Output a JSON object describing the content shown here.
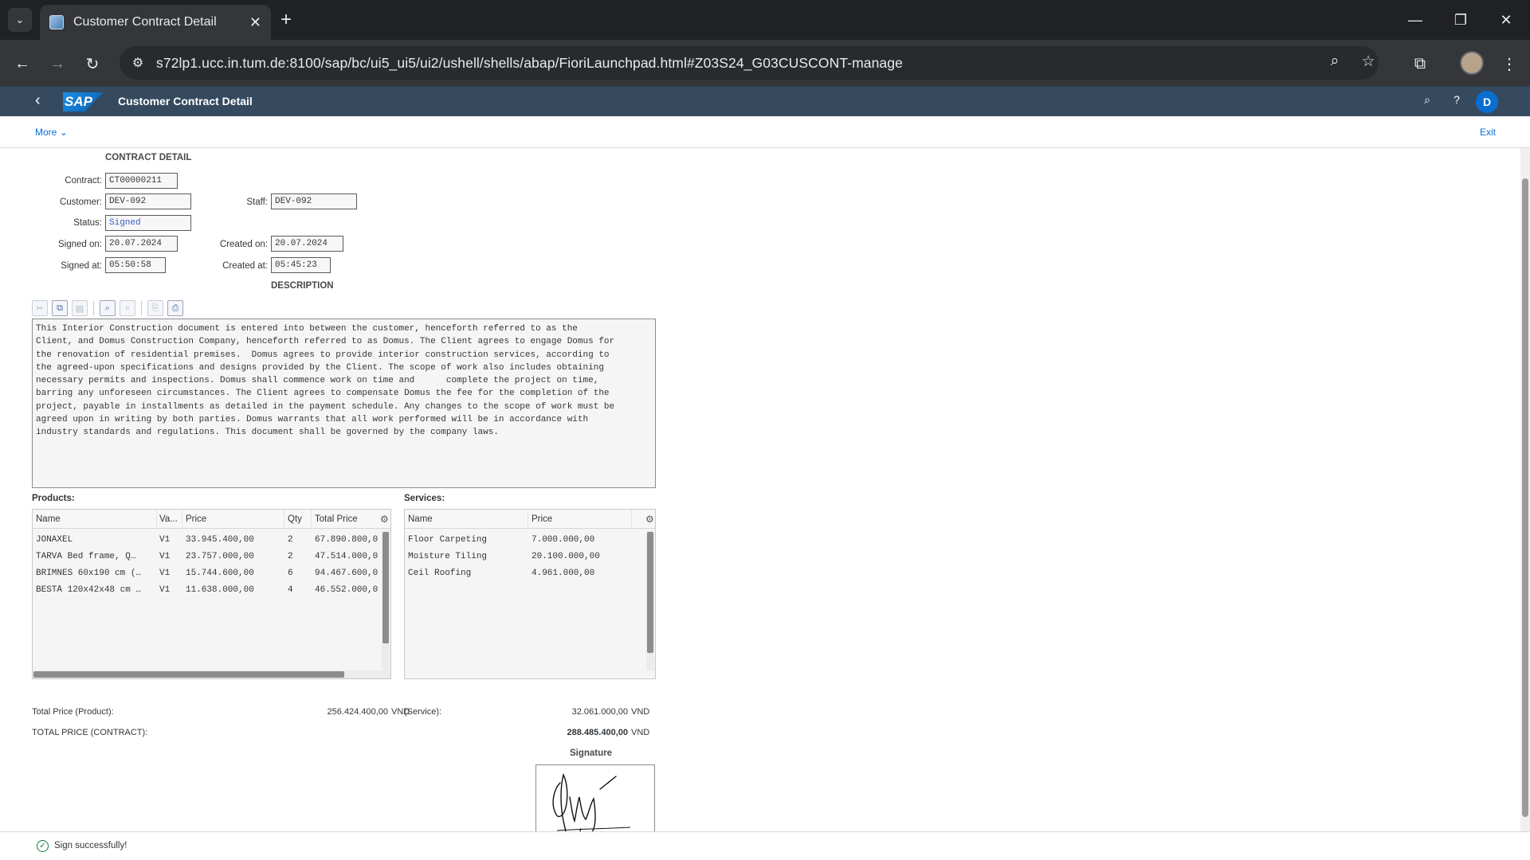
{
  "browser": {
    "tab_title": "Customer Contract Detail",
    "new_tab": "+",
    "url": "s72lp1.ucc.in.tum.de:8100/sap/bc/ui5_ui5/ui2/ushell/shells/abap/FioriLaunchpad.html#Z03S24_G03CUSCONT-manage"
  },
  "shell": {
    "logo": "SAP",
    "title": "Customer Contract Detail",
    "user_initial": "D"
  },
  "subheader": {
    "more": "More",
    "exit": "Exit"
  },
  "form": {
    "section_title": "CONTRACT DETAIL",
    "contract_label": "Contract:",
    "contract_value": "CT00000211",
    "customer_label": "Customer:",
    "customer_value": "DEV-092",
    "staff_label": "Staff:",
    "staff_value": "DEV-092",
    "status_label": "Status:",
    "status_value": "Signed",
    "signed_on_label": "Signed on:",
    "signed_on_value": "20.07.2024",
    "created_on_label": "Created on:",
    "created_on_value": "20.07.2024",
    "signed_at_label": "Signed at:",
    "signed_at_value": "05:50:58",
    "created_at_label": "Created at:",
    "created_at_value": "05:45:23",
    "description_title": "DESCRIPTION"
  },
  "description_text": "This Interior Construction document is entered into between the customer, henceforth referred to as the\nClient, and Domus Construction Company, henceforth referred to as Domus. The Client agrees to engage Domus for\nthe renovation of residential premises.  Domus agrees to provide interior construction services, according to\nthe agreed-upon specifications and designs provided by the Client. The scope of work also includes obtaining\nnecessary permits and inspections. Domus shall commence work on time and      complete the project on time,\nbarring any unforeseen circumstances. The Client agrees to compensate Domus the fee for the completion of the\nproject, payable in installments as detailed in the payment schedule. Any changes to the scope of work must be\nagreed upon in writing by both parties. Domus warrants that all work performed will be in accordance with\nindustry standards and regulations. This document shall be governed by the company laws.",
  "products": {
    "title": "Products:",
    "columns": [
      "Name",
      "Va...",
      "Price",
      "Qty",
      "Total Price"
    ],
    "rows": [
      [
        "JONAXEL",
        "V1",
        "33.945.400,00",
        "2",
        "67.890.800,0"
      ],
      [
        "TARVA Bed frame,  Q…",
        "V1",
        "23.757.000,00",
        "2",
        "47.514.000,0"
      ],
      [
        "BRIMNES 60x190 cm (…",
        "V1",
        "15.744.600,00",
        "6",
        "94.467.600,0"
      ],
      [
        "BESTÅ 120x42x48 cm …",
        "V1",
        "11.638.000,00",
        "4",
        "46.552.000,0"
      ]
    ]
  },
  "services": {
    "title": "Services:",
    "columns": [
      "Name",
      "Price"
    ],
    "rows": [
      [
        "Floor Carpeting",
        "7.000.000,00"
      ],
      [
        "Moisture Tiling",
        "20.100.000,00"
      ],
      [
        "Ceil Roofing",
        "4.961.000,00"
      ]
    ]
  },
  "totals": {
    "product_label": "Total Price (Product):",
    "product_value": "256.424.400,00",
    "currency": "VND",
    "service_label": "(Service):",
    "service_value": "32.061.000,00",
    "contract_label": "TOTAL PRICE (CONTRACT):",
    "contract_value": "288.485.400,00"
  },
  "signature_title": "Signature",
  "message": "Sign successfully!",
  "colors": {
    "shell_bg": "#354a5f",
    "link": "#0a6ed1",
    "success": "#107e3e"
  }
}
